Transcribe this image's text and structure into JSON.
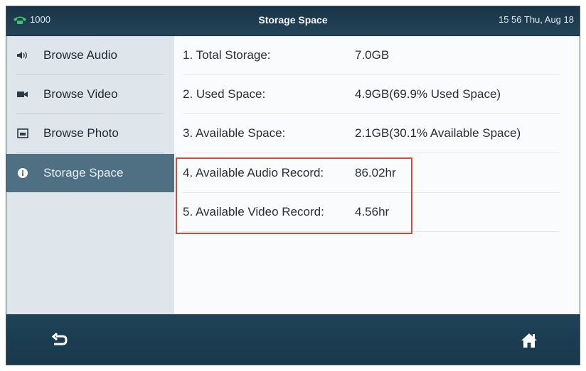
{
  "status_bar": {
    "account": "1000",
    "title": "Storage Space",
    "clock": "15 56 Thu, Aug 18"
  },
  "sidebar": {
    "items": [
      {
        "label": "Browse Audio",
        "icon": "speaker-icon",
        "active": false
      },
      {
        "label": "Browse Video",
        "icon": "video-camera-icon",
        "active": false
      },
      {
        "label": "Browse Photo",
        "icon": "photo-icon",
        "active": false
      },
      {
        "label": "Storage Space",
        "icon": "info-icon",
        "active": true
      }
    ]
  },
  "storage": {
    "rows": [
      {
        "label": "1. Total Storage:",
        "value": "7.0GB"
      },
      {
        "label": "2. Used Space:",
        "value": "4.9GB(69.9% Used Space)"
      },
      {
        "label": "3. Available Space:",
        "value": "2.1GB(30.1% Available Space)"
      },
      {
        "label": "4. Available Audio Record:",
        "value": "86.02hr"
      },
      {
        "label": "5. Available Video Record:",
        "value": "4.56hr"
      }
    ]
  },
  "colors": {
    "highlight_box": "#d9473f",
    "active_sidebar": "#4f6f82",
    "topbar": "#1e3a4c"
  },
  "bottom_bar": {
    "back_icon": "back-arrow-icon",
    "home_icon": "home-icon"
  }
}
